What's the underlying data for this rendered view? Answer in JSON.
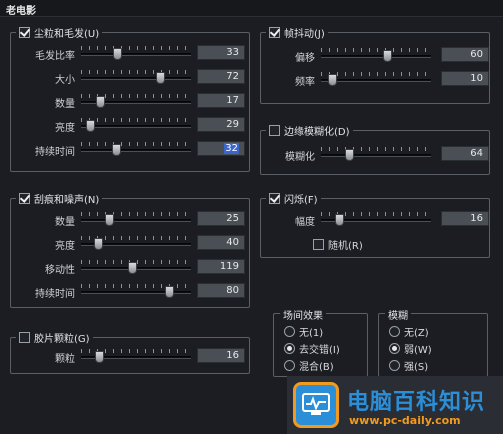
{
  "window": {
    "title": "老电影"
  },
  "dust": {
    "title": "尘粒和毛发(U)",
    "checked": true,
    "rows": [
      {
        "label": "毛发比率",
        "value": "33",
        "pct": 33
      },
      {
        "label": "大小",
        "value": "72",
        "pct": 72
      },
      {
        "label": "数量",
        "value": "17",
        "pct": 17
      },
      {
        "label": "亮度",
        "value": "29",
        "pct": 8
      },
      {
        "label": "持续时间",
        "value": "32",
        "pct": 32,
        "selected": true
      }
    ]
  },
  "scratch": {
    "title": "刮痕和噪声(N)",
    "checked": true,
    "rows": [
      {
        "label": "数量",
        "value": "25",
        "pct": 25
      },
      {
        "label": "亮度",
        "value": "40",
        "pct": 15
      },
      {
        "label": "移动性",
        "value": "119",
        "pct": 46
      },
      {
        "label": "持续时间",
        "value": "80",
        "pct": 80
      }
    ]
  },
  "grain": {
    "title": "胶片颗粒(G)",
    "checked": false,
    "rows": [
      {
        "label": "颗粒",
        "value": "16",
        "pct": 16
      }
    ]
  },
  "shake": {
    "title": "帧抖动(J)",
    "checked": true,
    "rows": [
      {
        "label": "偏移",
        "value": "60",
        "pct": 60
      },
      {
        "label": "频率",
        "value": "10",
        "pct": 10
      }
    ]
  },
  "blur": {
    "title": "边缘模糊化(D)",
    "checked": false,
    "rows": [
      {
        "label": "模糊化",
        "value": "64",
        "pct": 25
      }
    ]
  },
  "flicker": {
    "title": "闪烁(F)",
    "checked": true,
    "rows": [
      {
        "label": "幅度",
        "value": "16",
        "pct": 16
      }
    ],
    "random_label": "随机(R)",
    "random_checked": false
  },
  "scene": {
    "title": "场间效果",
    "options": [
      {
        "label": "无(1)",
        "selected": false
      },
      {
        "label": "去交错(I)",
        "selected": true
      },
      {
        "label": "混合(B)",
        "selected": false
      }
    ]
  },
  "blurlevel": {
    "title": "模糊",
    "options": [
      {
        "label": "无(Z)",
        "selected": false
      },
      {
        "label": "弱(W)",
        "selected": true
      },
      {
        "label": "强(S)",
        "selected": false
      }
    ]
  },
  "watermark": {
    "brand": "电脑百科知识",
    "url": "www.pc-daily.com"
  }
}
